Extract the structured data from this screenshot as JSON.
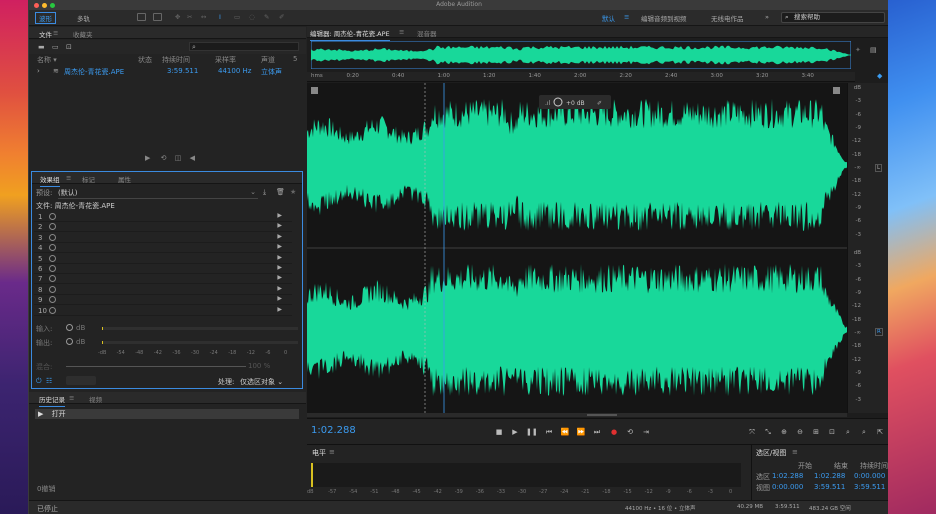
{
  "window": {
    "title": "Adobe Audition"
  },
  "toolbar": {
    "waveform_label": "波形",
    "multitrack_label": "多轨",
    "workspace_default": "默认",
    "workspace_edit_video": "编辑音频到视频",
    "workspace_wireless": "无线电作品",
    "more": "»",
    "search_placeholder": "搜索帮助"
  },
  "files_panel": {
    "tab_files": "文件",
    "tab_favorites": "收藏夹",
    "col_name": "名称 ▾",
    "col_status": "状态",
    "col_duration": "持续时间",
    "col_samplerate": "采样率",
    "col_channels": "声道",
    "col_extra": "5",
    "file": {
      "name": "周杰伦-青花瓷.APE",
      "duration": "3:59.511",
      "samplerate": "44100 Hz",
      "channels": "立体声"
    }
  },
  "effects_panel": {
    "tab_effects": "效果组",
    "tab_markers": "标记",
    "tab_properties": "属性",
    "preset_label": "预设:",
    "preset_value": "(默认)",
    "file_label": "文件: 周杰伦-青花瓷.APE",
    "slots": [
      "1",
      "2",
      "3",
      "4",
      "5",
      "6",
      "7",
      "8",
      "9",
      "10"
    ],
    "input_label": "输入:",
    "output_label": "输出:",
    "db_zero": "dB",
    "mix_label": "混合:",
    "mix_value": "100 %",
    "meter_ticks": [
      "-dB",
      "-54",
      "-48",
      "-42",
      "-36",
      "-30",
      "-24",
      "-18",
      "-12",
      "-6",
      "0"
    ],
    "process_label": "处理:",
    "process_value": "仅选区对象"
  },
  "history_panel": {
    "tab_history": "历史记录",
    "tab_video": "视频",
    "item": "打开",
    "undo_count": "0撤销",
    "status": "已停止"
  },
  "editor": {
    "tab_editor": "编辑器: 周杰伦-青花瓷.APE",
    "tab_mixer": "混音器",
    "time_ticks": [
      "hms",
      "0:20",
      "0:40",
      "1:00",
      "1:20",
      "1:40",
      "2:00",
      "2:20",
      "2:40",
      "3:00",
      "3:20",
      "3:40"
    ],
    "gain_value": "+0 dB",
    "db_ticks_top": [
      "dB",
      "-3",
      "-6",
      "-9",
      "-12",
      "-18",
      "-∞",
      "-18",
      "-12",
      "-9",
      "-6",
      "-3"
    ],
    "db_ticks_bottom": [
      "dB",
      "-3",
      "-6",
      "-9",
      "-12",
      "-18",
      "-∞",
      "-18",
      "-12",
      "-9",
      "-6",
      "-3"
    ],
    "channel_top": "L",
    "channel_bottom": "R",
    "current_time": "1:02.288",
    "waveform_color": "#18d89a"
  },
  "levels_panel": {
    "title": "电平",
    "ticks": [
      "dB",
      "-57",
      "-54",
      "-51",
      "-48",
      "-45",
      "-42",
      "-39",
      "-36",
      "-33",
      "-30",
      "-27",
      "-24",
      "-21",
      "-18",
      "-15",
      "-12",
      "-9",
      "-6",
      "-3",
      "0"
    ]
  },
  "selection_view": {
    "title": "选区/视图",
    "col_start": "开始",
    "col_end": "结束",
    "col_duration": "持续时间",
    "sel_label": "选区",
    "sel_start": "1:02.288",
    "sel_end": "1:02.288",
    "sel_duration": "0:00.000",
    "view_label": "视图",
    "view_start": "0:00.000",
    "view_end": "3:59.511",
    "view_duration": "3:59.511"
  },
  "statusbar": {
    "format": "44100 Hz • 16 位 • 立体声",
    "size": "40.29 MB",
    "duration": "3:59.511",
    "free": "483.24 GB 空闲"
  },
  "colors": {
    "accent": "#3b8be0",
    "waveform": "#18d89a",
    "playhead": "#3b9bf0"
  }
}
